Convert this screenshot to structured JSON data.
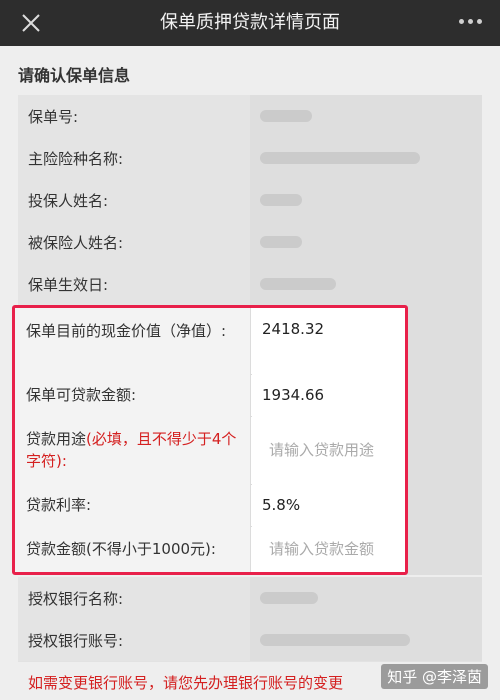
{
  "nav": {
    "title": "保单质押贷款详情页面"
  },
  "section_title": "请确认保单信息",
  "rows_top": [
    {
      "label": "保单号:"
    },
    {
      "label": "主险险种名称:"
    },
    {
      "label": "投保人姓名:"
    },
    {
      "label": "被保险人姓名:"
    },
    {
      "label": "保单生效日:"
    }
  ],
  "highlight": {
    "cash_value_label": "保单目前的现金价值（净值）:",
    "cash_value": "2418.32",
    "loanable_label": "保单可贷款金额:",
    "loanable_value": "1934.66",
    "purpose_label": "贷款用途",
    "purpose_required": "(必填，且不得少于4个字符):",
    "purpose_placeholder": "请输入贷款用途",
    "rate_label": "贷款利率:",
    "rate_value": "5.8%",
    "amount_label": "贷款金额(不得小于1000元):",
    "amount_placeholder": "请输入贷款金额"
  },
  "rows_bottom": [
    {
      "label": "授权银行名称:"
    },
    {
      "label": "授权银行账号:"
    }
  ],
  "notice": "如需变更银行账号，请您先办理银行账号的变更",
  "watermark": "知乎 @李泽茵",
  "colors": {
    "nav_bg": "#2d2d2d",
    "highlight_border": "#e8204a",
    "required": "#d42020"
  }
}
